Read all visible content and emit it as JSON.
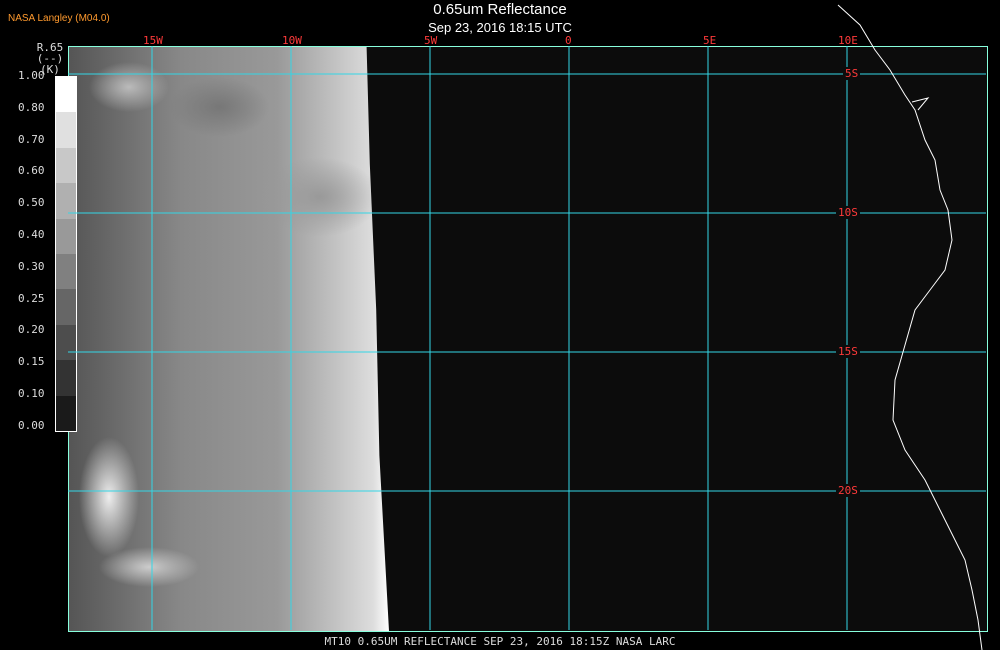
{
  "header": {
    "title": "0.65um Reflectance",
    "subtitle": "Sep 23, 2016 18:15 UTC",
    "source": "NASA Langley (M04.0)"
  },
  "legend": {
    "title_line1": "R.65",
    "title_line2": "(--)",
    "title_line3": "(K)",
    "ticks": [
      "1.00",
      "0.80",
      "0.70",
      "0.60",
      "0.50",
      "0.40",
      "0.30",
      "0.25",
      "0.20",
      "0.15",
      "0.10",
      "0.00"
    ]
  },
  "map": {
    "longitude_labels": [
      "15W",
      "10W",
      "5W",
      "0",
      "5E",
      "10E"
    ],
    "latitude_labels": [
      "5S",
      "10S",
      "15S",
      "20S"
    ],
    "grid_color": "#33d6e6",
    "label_color": "#ff3a3a"
  },
  "footer": "MT10  0.65UM REFLECTANCE   SEP 23, 2016 18:15Z   NASA LARC"
}
